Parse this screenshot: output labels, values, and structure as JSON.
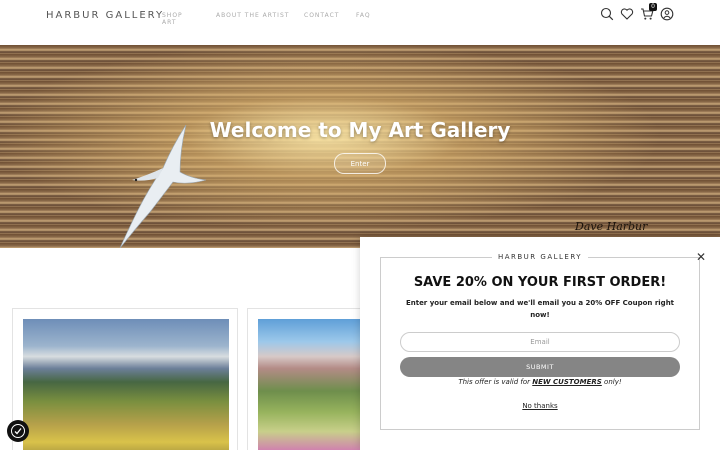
{
  "header": {
    "brand": "HARBUR GALLERY",
    "nav": [
      "SHOP ART",
      "ABOUT THE ARTIST",
      "CONTACT",
      "FAQ"
    ],
    "cart_count": "0",
    "icons": [
      "search-icon",
      "heart-icon",
      "cart-icon",
      "account-icon"
    ]
  },
  "hero": {
    "title": "Welcome to My Art Gallery",
    "button": "Enter",
    "signature": "Dave Harbur"
  },
  "popup": {
    "brand": "HARBUR GALLERY",
    "headline": "SAVE 20% ON YOUR FIRST ORDER!",
    "subtext": "Enter your email below and we'll email you a 20% OFF Coupon right now!",
    "email_placeholder": "Email",
    "submit": "SUBMIT",
    "offer_prefix": "This offer is valid for ",
    "offer_highlight": "NEW CUSTOMERS",
    "offer_suffix": " only!",
    "decline": "No thanks"
  },
  "colors": {
    "submit_bg": "#858585",
    "accent": "#111111"
  }
}
